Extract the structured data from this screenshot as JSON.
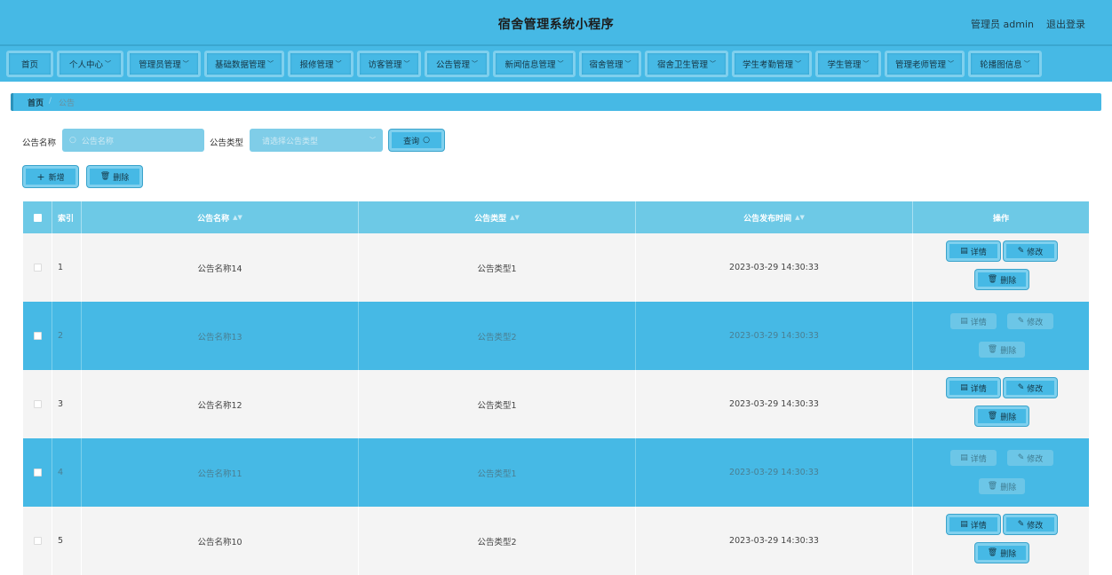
{
  "header": {
    "title": "宿舍管理系统小程序",
    "user": "管理员 admin",
    "logout": "退出登录"
  },
  "nav": [
    {
      "label": "首页",
      "chevron": false
    },
    {
      "label": "个人中心",
      "chevron": true
    },
    {
      "label": "管理员管理",
      "chevron": true
    },
    {
      "label": "基础数据管理",
      "chevron": true
    },
    {
      "label": "报修管理",
      "chevron": true
    },
    {
      "label": "访客管理",
      "chevron": true
    },
    {
      "label": "公告管理",
      "chevron": true
    },
    {
      "label": "新闻信息管理",
      "chevron": true
    },
    {
      "label": "宿舍管理",
      "chevron": true
    },
    {
      "label": "宿舍卫生管理",
      "chevron": true
    },
    {
      "label": "学生考勤管理",
      "chevron": true
    },
    {
      "label": "学生管理",
      "chevron": true
    },
    {
      "label": "管理老师管理",
      "chevron": true
    },
    {
      "label": "轮播图信息",
      "chevron": true
    }
  ],
  "breadcrumb": {
    "home": "首页",
    "separator": "/",
    "current": "公告"
  },
  "search": {
    "name_label": "公告名称",
    "name_placeholder": "公告名称",
    "type_label": "公告类型",
    "type_placeholder": "请选择公告类型",
    "query_button": "查询"
  },
  "actions": {
    "add": "新增",
    "delete": "删除"
  },
  "table": {
    "columns": [
      "索引",
      "公告名称",
      "公告类型",
      "公告发布时间",
      "操作"
    ],
    "row_actions": {
      "detail": "详情",
      "edit": "修改",
      "delete": "删除"
    },
    "rows": [
      {
        "index": "1",
        "name": "公告名称14",
        "type": "公告类型1",
        "time": "2023-03-29 14:30:33"
      },
      {
        "index": "2",
        "name": "公告名称13",
        "type": "公告类型2",
        "time": "2023-03-29 14:30:33"
      },
      {
        "index": "3",
        "name": "公告名称12",
        "type": "公告类型1",
        "time": "2023-03-29 14:30:33"
      },
      {
        "index": "4",
        "name": "公告名称11",
        "type": "公告类型1",
        "time": "2023-03-29 14:30:33"
      },
      {
        "index": "5",
        "name": "公告名称10",
        "type": "公告类型2",
        "time": "2023-03-29 14:30:33"
      }
    ]
  },
  "colors": {
    "primary": "#46b9e5",
    "border_light": "#7fd0ee",
    "header_row": "#6dc9e6",
    "row_light": "#f4f4f4"
  }
}
